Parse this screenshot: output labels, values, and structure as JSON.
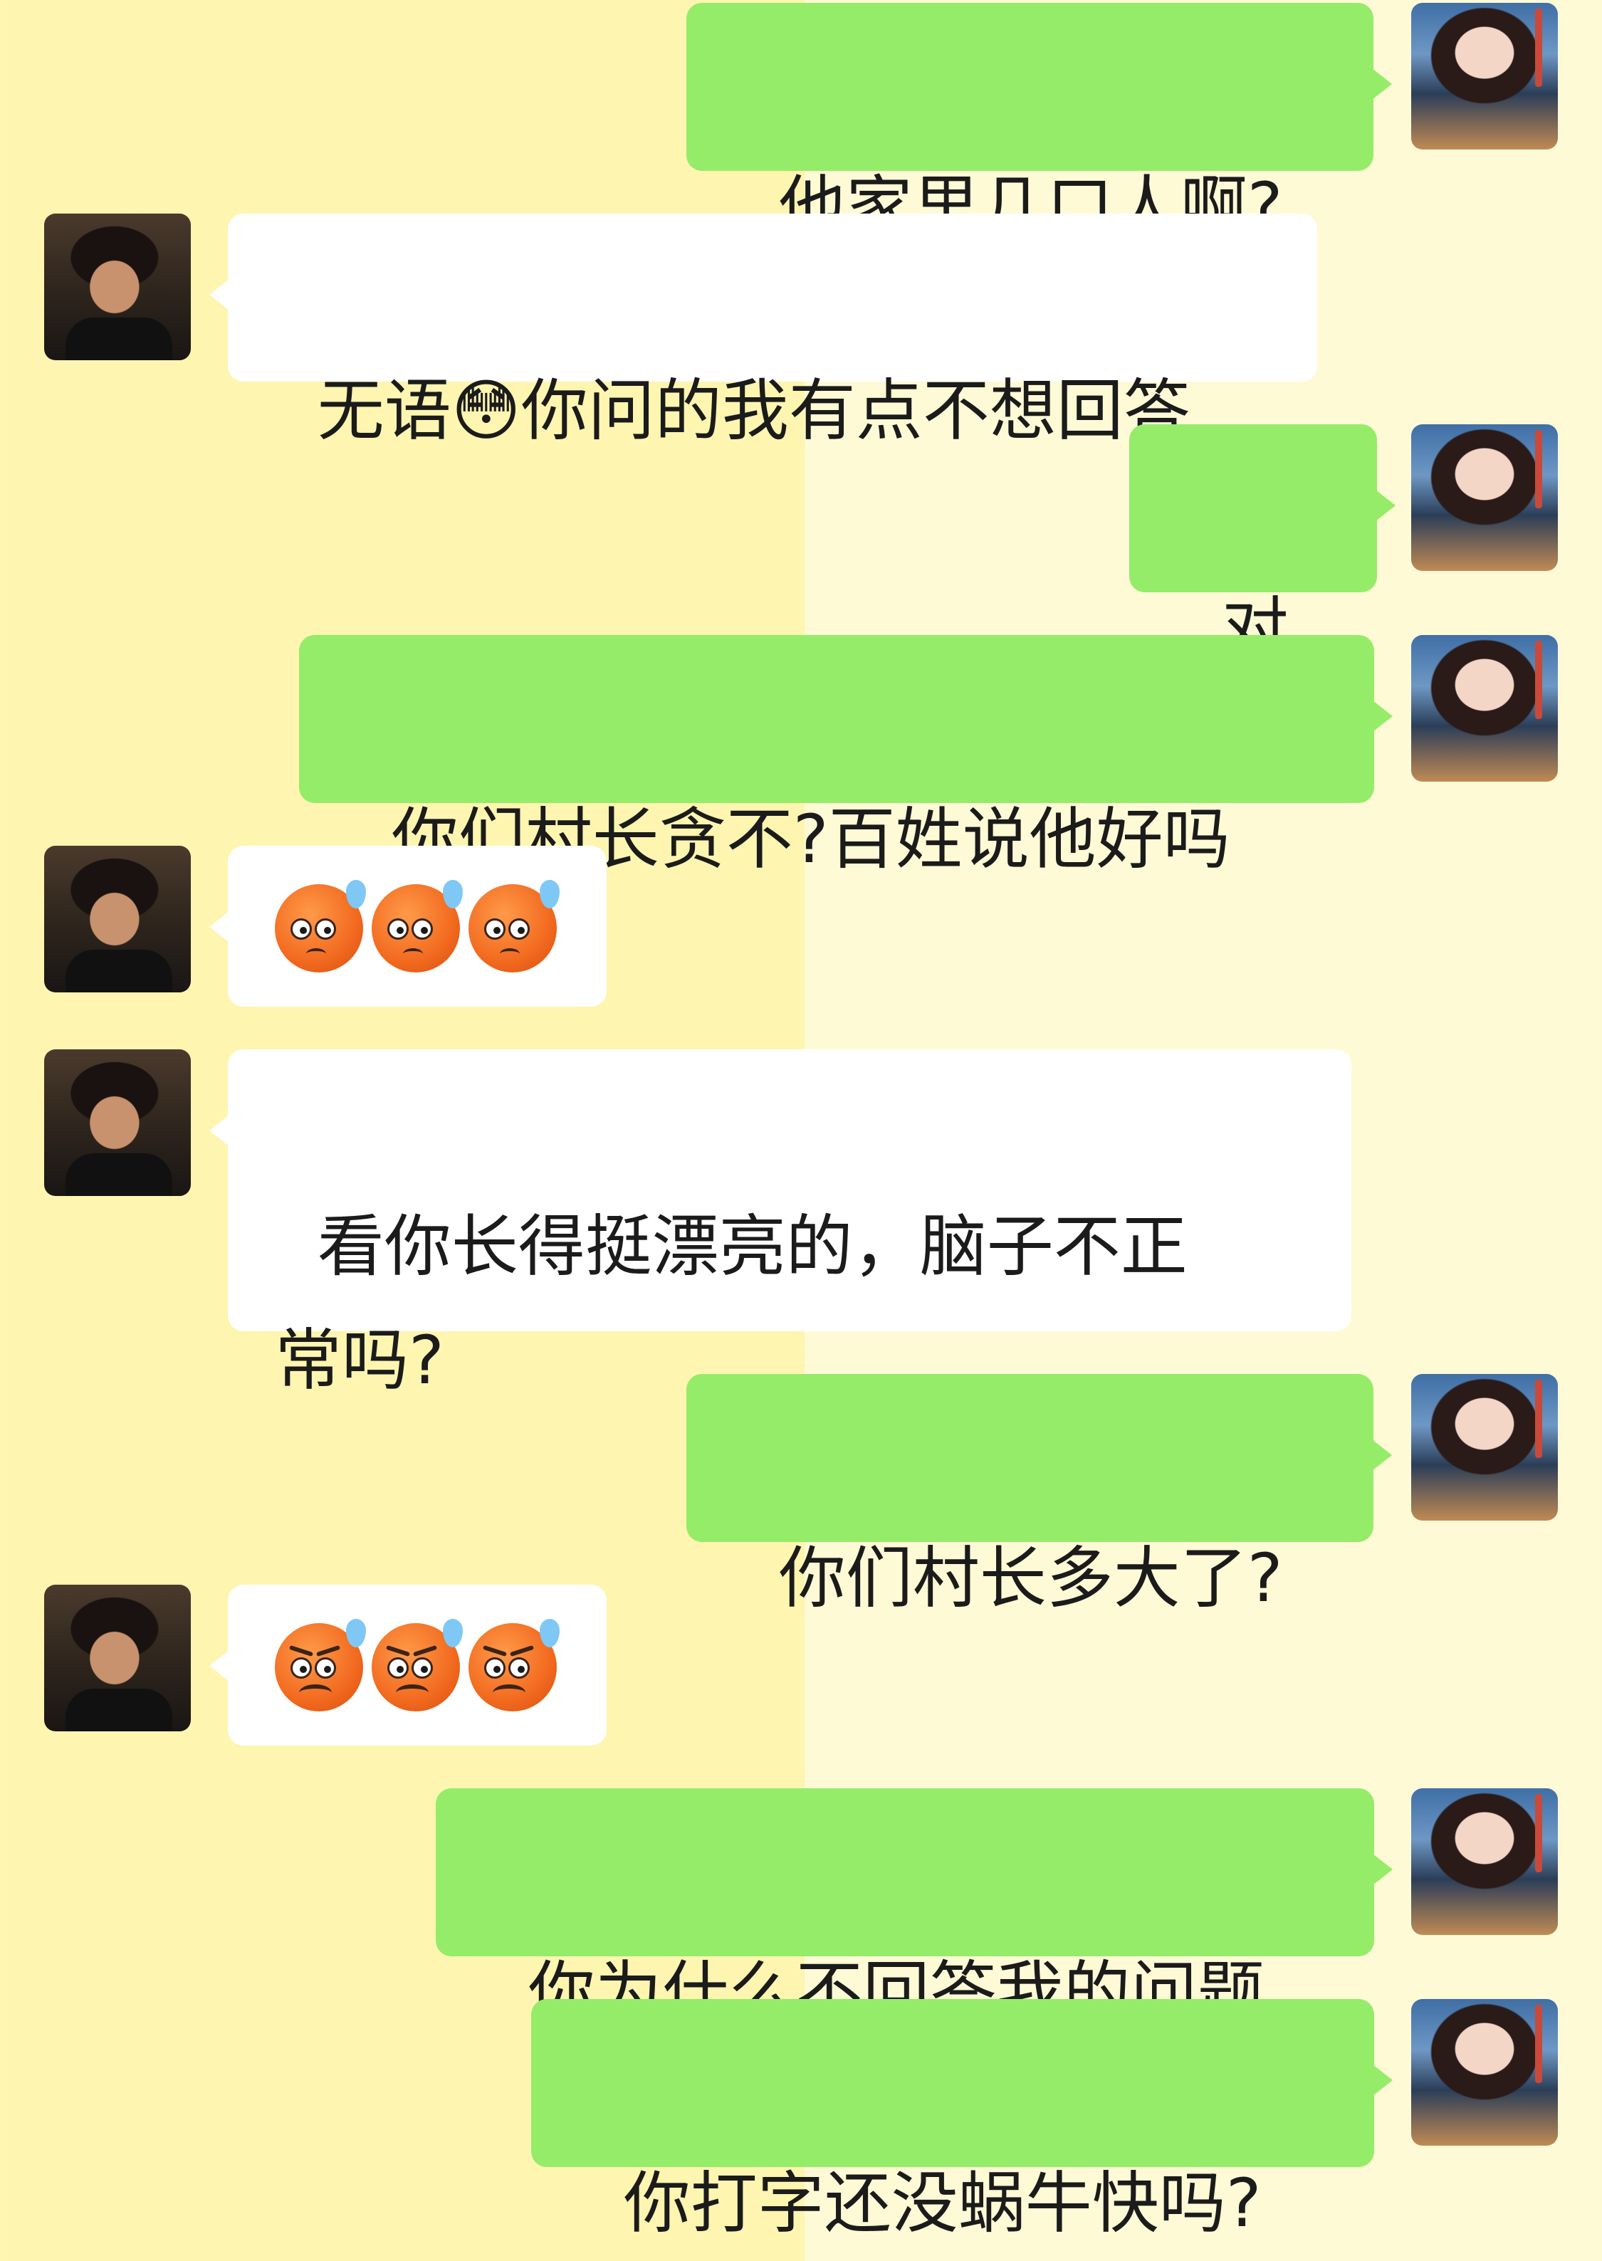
{
  "messages": [
    {
      "sender": "self",
      "text": "他家里几口人啊?"
    },
    {
      "sender": "other",
      "text": "无语😳你问的我有点不想回答"
    },
    {
      "sender": "self",
      "text": "对了"
    },
    {
      "sender": "self",
      "text": "你们村长贪不?百姓说他好吗"
    },
    {
      "sender": "other",
      "emoji": [
        "anxious-face-with-sweat",
        "anxious-face-with-sweat",
        "anxious-face-with-sweat"
      ]
    },
    {
      "sender": "other",
      "text": "看你长得挺漂亮的，脑子不正\n常吗?"
    },
    {
      "sender": "self",
      "text": "你们村长多大了?"
    },
    {
      "sender": "other",
      "emoji": [
        "weary-angry-face-with-sweat",
        "weary-angry-face-with-sweat",
        "weary-angry-face-with-sweat"
      ]
    },
    {
      "sender": "self",
      "text": "你为什么不回答我的问题"
    },
    {
      "sender": "self",
      "text": "你打字还没蜗牛快吗?"
    }
  ],
  "colors": {
    "self_bubble": "#95ec69",
    "other_bubble": "#ffffff",
    "background_left": "#fdf5b0",
    "background_right": "#fefad6"
  }
}
